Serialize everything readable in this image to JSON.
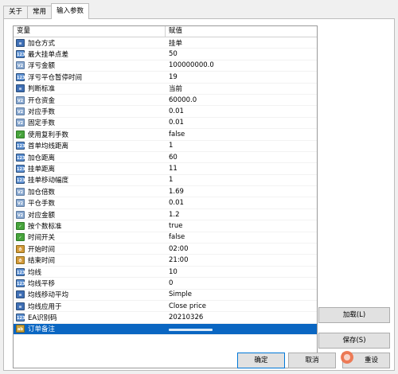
{
  "tabs": [
    {
      "label": "关于"
    },
    {
      "label": "常用"
    },
    {
      "label": "输入参数",
      "active": true
    }
  ],
  "grid": {
    "col_variable": "变量",
    "col_value": "赋值",
    "rows": [
      {
        "icon": "enum",
        "name": "加仓方式",
        "value": "挂单"
      },
      {
        "icon": "num",
        "name": "最大挂单点差",
        "value": "50"
      },
      {
        "icon": "dbl",
        "name": "浮亏金额",
        "value": "100000000.0"
      },
      {
        "icon": "num",
        "name": "浮亏平仓暂停时间",
        "value": "19"
      },
      {
        "icon": "enum",
        "name": "判断标准",
        "value": "当前"
      },
      {
        "icon": "dbl",
        "name": "开仓资金",
        "value": "60000.0"
      },
      {
        "icon": "dbl",
        "name": "对应手数",
        "value": "0.01"
      },
      {
        "icon": "dbl",
        "name": "固定手数",
        "value": "0.01"
      },
      {
        "icon": "bool",
        "name": "使用复利手数",
        "value": "false"
      },
      {
        "icon": "num",
        "name": "首单均线距离",
        "value": "1"
      },
      {
        "icon": "num",
        "name": "加仓距离",
        "value": "60"
      },
      {
        "icon": "num",
        "name": "挂单距离",
        "value": "11"
      },
      {
        "icon": "num",
        "name": "挂单移动幅度",
        "value": "1"
      },
      {
        "icon": "dbl",
        "name": "加仓倍数",
        "value": "1.69"
      },
      {
        "icon": "dbl",
        "name": "平仓手数",
        "value": "0.01"
      },
      {
        "icon": "dbl",
        "name": "对应金额",
        "value": "1.2"
      },
      {
        "icon": "bool",
        "name": "按个数标准",
        "value": "true"
      },
      {
        "icon": "bool",
        "name": "时间开关",
        "value": "false"
      },
      {
        "icon": "time",
        "name": "开始时间",
        "value": "02:00"
      },
      {
        "icon": "time",
        "name": "结束时间",
        "value": "21:00"
      },
      {
        "icon": "num",
        "name": "均线",
        "value": "10"
      },
      {
        "icon": "num",
        "name": "均线平移",
        "value": "0"
      },
      {
        "icon": "enum",
        "name": "均线移动平均",
        "value": "Simple"
      },
      {
        "icon": "enum",
        "name": "均线应用于",
        "value": "Close price"
      },
      {
        "icon": "num",
        "name": "EA识别码",
        "value": "20210326"
      },
      {
        "icon": "str",
        "name": "订单备注",
        "value": "",
        "selected": true
      }
    ]
  },
  "buttons": {
    "load": "加载(L)",
    "save": "保存(S)",
    "ok": "确定",
    "cancel": "取消",
    "reset": "重设"
  },
  "icon_labels": {
    "num": "123",
    "dbl": "V2",
    "enum": "≡",
    "bool": "✓",
    "str": "ab",
    "time": "⏱"
  }
}
